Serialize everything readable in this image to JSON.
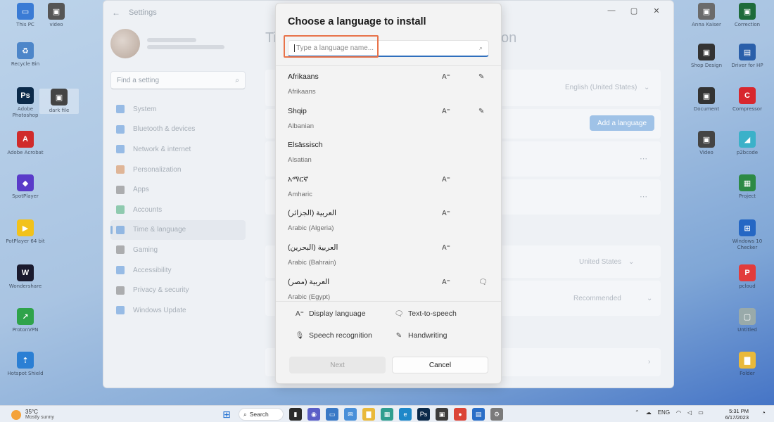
{
  "desktop": {
    "left_icons": [
      {
        "label": "This PC",
        "color": "#3a7bd5",
        "glyph": "▭"
      },
      {
        "label": "Recycle Bin",
        "color": "#4d86c9",
        "glyph": "♻"
      },
      {
        "label": "Adobe Photoshop",
        "color": "#0b2a4a",
        "glyph": "Ps"
      },
      {
        "label": "Adobe Acrobat",
        "color": "#d02b2b",
        "glyph": "A"
      },
      {
        "label": "SpotPlayer",
        "color": "#5a3bc9",
        "glyph": "◆"
      },
      {
        "label": "PotPlayer 64 bit",
        "color": "#f2c21b",
        "glyph": "▶"
      },
      {
        "label": "Wondershare",
        "color": "#1a1a2e",
        "glyph": "W"
      },
      {
        "label": "ProtonVPN",
        "color": "#2fa34a",
        "glyph": "↗"
      },
      {
        "label": "Hotspot Shield",
        "color": "#2b7fd4",
        "glyph": "⇡"
      }
    ],
    "mid_icons": [
      {
        "label": "video",
        "color": "#555",
        "glyph": "▣"
      },
      {
        "label": "dark file",
        "color": "#444",
        "glyph": "▣"
      }
    ],
    "right_icons": [
      {
        "label": "Anna Kaiser",
        "color": "#6b6b6b",
        "glyph": "▣"
      },
      {
        "label": "Correction",
        "color": "#1e6b3a",
        "glyph": "▣"
      },
      {
        "label": "Shop Design",
        "color": "#333",
        "glyph": "▣"
      },
      {
        "label": "Driver for HP",
        "color": "#2a5faa",
        "glyph": "▤"
      },
      {
        "label": "Document",
        "color": "#333",
        "glyph": "▣"
      },
      {
        "label": "Compressor",
        "color": "#d8272e",
        "glyph": "C"
      },
      {
        "label": "Video",
        "color": "#444",
        "glyph": "▣"
      },
      {
        "label": "p2bcode",
        "color": "#3bb1c9",
        "glyph": "◢"
      },
      {
        "label": "Project",
        "color": "#2d8a45",
        "glyph": "▦"
      },
      {
        "label": "Windows 10 Checker",
        "color": "#2567c4",
        "glyph": "⊞"
      },
      {
        "label": "pcloud",
        "color": "#e23c3c",
        "glyph": "P"
      },
      {
        "label": "Untitled",
        "color": "#9aa",
        "glyph": "▢"
      },
      {
        "label": "Folder",
        "color": "#e9b93b",
        "glyph": "▇"
      }
    ]
  },
  "settings": {
    "window_title": "Settings",
    "search_placeholder": "Find a setting",
    "nav": [
      {
        "label": "System",
        "color": "#3f86d6"
      },
      {
        "label": "Bluetooth & devices",
        "color": "#3f86d6"
      },
      {
        "label": "Network & internet",
        "color": "#3f86d6"
      },
      {
        "label": "Personalization",
        "color": "#d07a3a"
      },
      {
        "label": "Apps",
        "color": "#6a6a6a"
      },
      {
        "label": "Accounts",
        "color": "#2fa46a"
      },
      {
        "label": "Time & language",
        "color": "#3f86d6"
      },
      {
        "label": "Gaming",
        "color": "#6a6a6a"
      },
      {
        "label": "Accessibility",
        "color": "#3f86d6"
      },
      {
        "label": "Privacy & security",
        "color": "#6a6a6a"
      },
      {
        "label": "Windows Update",
        "color": "#3f86d6"
      }
    ],
    "heading_left": "Ti",
    "heading_right": "on",
    "display_language": "English (United States)",
    "add_language": "Add a language",
    "region": "United States",
    "regional_format": "Recommended"
  },
  "dialog": {
    "title": "Choose a language to install",
    "search_placeholder": "Type a language name...",
    "languages": [
      {
        "native": "Afrikaans",
        "english": "Afrikaans",
        "f1": "A⁼",
        "f2": "✎"
      },
      {
        "native": "Shqip",
        "english": "Albanian",
        "f1": "A⁼",
        "f2": "✎"
      },
      {
        "native": "Elsässisch",
        "english": "Alsatian",
        "f1": "",
        "f2": ""
      },
      {
        "native": "አማርኛ",
        "english": "Amharic",
        "f1": "A⁼",
        "f2": ""
      },
      {
        "native": "العربية (الجزائر)",
        "english": "Arabic (Algeria)",
        "f1": "A⁼",
        "f2": ""
      },
      {
        "native": "العربية (البحرين)",
        "english": "Arabic (Bahrain)",
        "f1": "A⁼",
        "f2": ""
      },
      {
        "native": "العربية (مصر)",
        "english": "Arabic (Egypt)",
        "f1": "A⁼",
        "f2": "🗨"
      }
    ],
    "legend": [
      {
        "icon": "A⁼",
        "label": "Display language"
      },
      {
        "icon": "🗨",
        "label": "Text-to-speech"
      },
      {
        "icon": "🎙",
        "label": "Speech recognition"
      },
      {
        "icon": "✎",
        "label": "Handwriting"
      }
    ],
    "next_label": "Next",
    "cancel_label": "Cancel"
  },
  "taskbar": {
    "temperature": "35°C",
    "weather": "Mostly sunny",
    "search_label": "Search",
    "language": "ENG",
    "time": "5:31 PM",
    "date": "6/17/2023"
  }
}
